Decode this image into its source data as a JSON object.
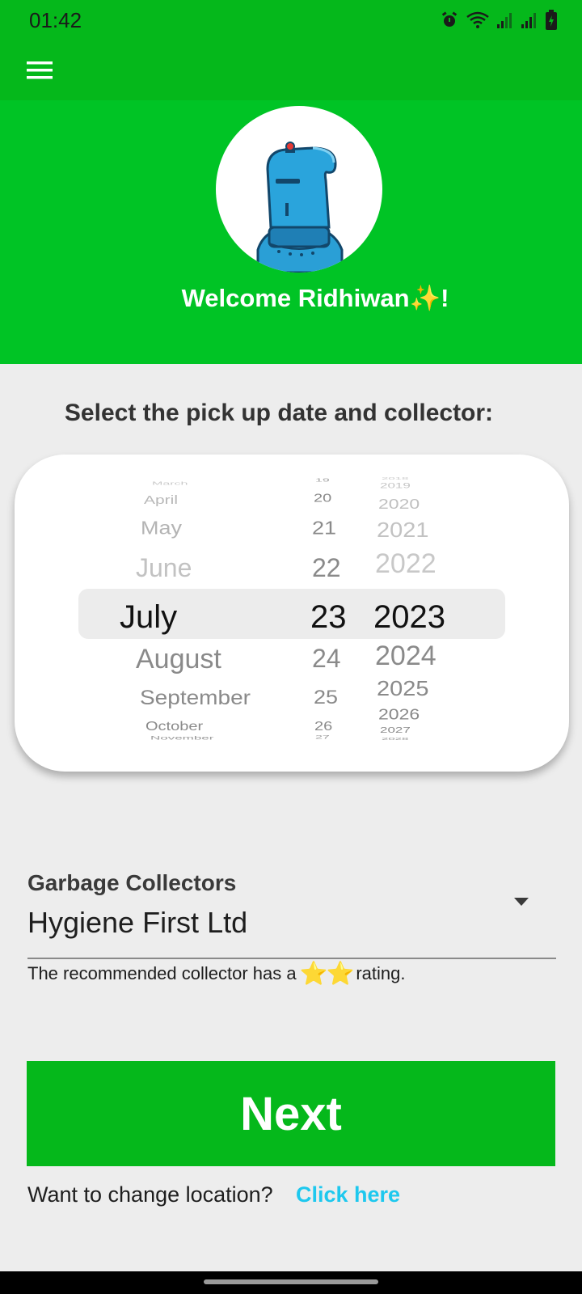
{
  "status_bar": {
    "time": "01:42",
    "icons": [
      "alarm-icon",
      "wifi-icon",
      "signal-icon",
      "signal-icon",
      "battery-charging-icon"
    ]
  },
  "app_bar": {
    "menu_icon": "menu-icon"
  },
  "header": {
    "avatar_icon": "robot-avatar",
    "welcome_text": "Welcome Ridhiwan✨!"
  },
  "instruction": "Select the pick up date and collector:",
  "date_picker": {
    "months": [
      "March",
      "April",
      "May",
      "June",
      "July",
      "August",
      "September",
      "October",
      "November"
    ],
    "days": [
      "19",
      "20",
      "21",
      "22",
      "23",
      "24",
      "25",
      "26",
      "27"
    ],
    "years": [
      "2018",
      "2019",
      "2020",
      "2021",
      "2022",
      "2023",
      "2024",
      "2025",
      "2026",
      "2027",
      "2028"
    ],
    "selected": {
      "month": "July",
      "day": "23",
      "year": "2023"
    }
  },
  "collectors": {
    "label": "Garbage Collectors",
    "selected": "Hygiene First Ltd",
    "rating_prefix": "The recommended collector has a",
    "rating_stars": "⭐⭐",
    "rating_suffix": "rating."
  },
  "next_button": "Next",
  "location": {
    "prompt": "Want to change location?",
    "link": "Click here"
  },
  "colors": {
    "primary_green": "#05b81b",
    "header_green": "#00c425",
    "link_cyan": "#1ec8ee",
    "star_yellow": "#f5b800"
  }
}
